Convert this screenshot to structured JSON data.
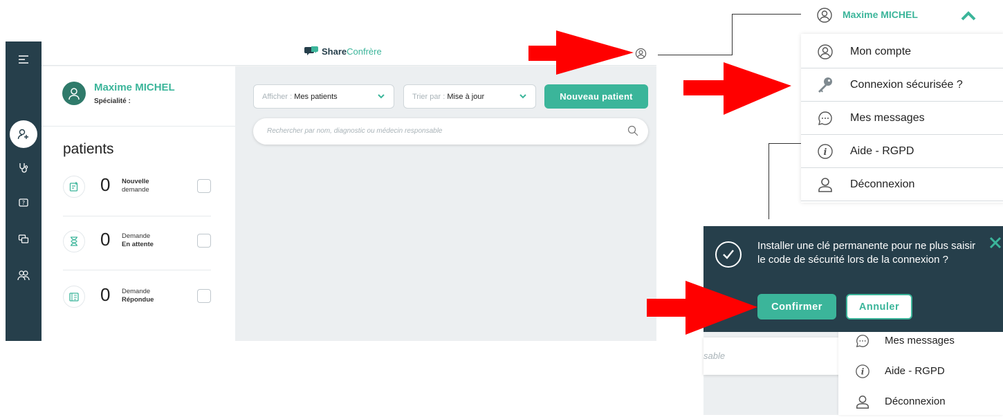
{
  "app": {
    "logo_share": "Share",
    "logo_confrere": "Confrère"
  },
  "profile": {
    "name": "Maxime MICHEL",
    "specialty_label": "Spécialité :"
  },
  "patients": {
    "title": "patients",
    "stats": [
      {
        "count": "0",
        "line1": "Nouvelle",
        "line2": "demande",
        "bold_line": 1
      },
      {
        "count": "0",
        "line1": "Demande",
        "line2": "En attente",
        "bold_line": 2
      },
      {
        "count": "0",
        "line1": "Demande",
        "line2": "Répondue",
        "bold_line": 2
      }
    ]
  },
  "filters": {
    "show_prefix": "Afficher :",
    "show_value": "Mes patients",
    "sort_prefix": "Trier par :",
    "sort_value": "Mise à jour",
    "new_patient_label": "Nouveau patient",
    "search_placeholder": "Rechercher par nom, diagnostic ou médecin responsable"
  },
  "user_menu": {
    "name": "Maxime MICHEL",
    "items": [
      {
        "label": "Mon compte",
        "icon": "user-circle-icon"
      },
      {
        "label": "Connexion sécurisée ?",
        "icon": "key-icon"
      },
      {
        "label": "Mes messages",
        "icon": "chat-bubble-icon"
      },
      {
        "label": "Aide - RGPD",
        "icon": "info-icon"
      },
      {
        "label": "Déconnexion",
        "icon": "person-icon"
      }
    ]
  },
  "popup": {
    "message": "Installer une clé permanente pour ne plus saisir le code de sécurité lors de la connexion ?",
    "confirm_label": "Confirmer",
    "cancel_label": "Annuler"
  },
  "lower_menu": {
    "search_fragment": "sable",
    "items": [
      {
        "label": "Mes messages",
        "icon": "chat-bubble-icon"
      },
      {
        "label": "Aide - RGPD",
        "icon": "info-icon"
      },
      {
        "label": "Déconnexion",
        "icon": "person-icon"
      }
    ]
  },
  "colors": {
    "accent": "#3bb59a",
    "sidebar": "#263f4b",
    "main_bg": "#eceff1",
    "arrow": "#ff0000"
  }
}
